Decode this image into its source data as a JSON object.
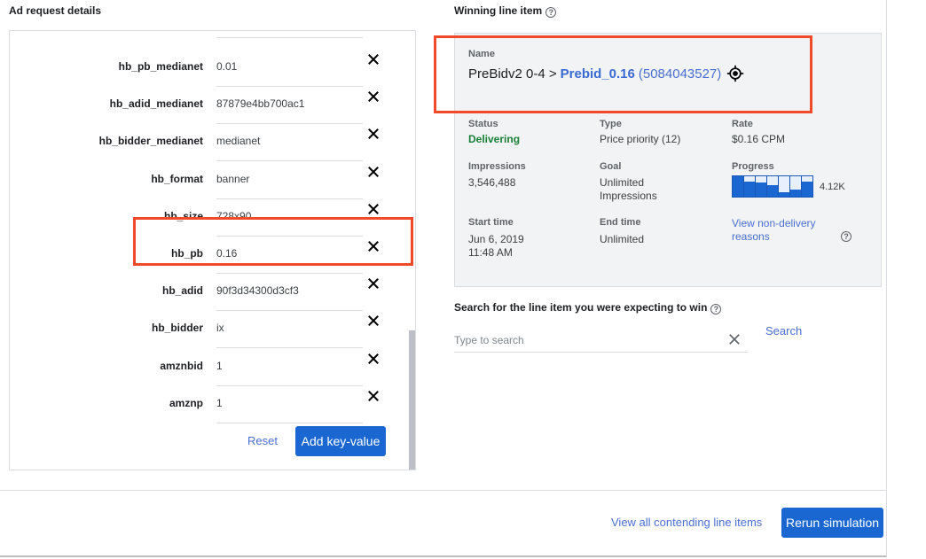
{
  "left": {
    "title": "Ad request details",
    "rows": [
      {
        "key": "hb_pb_medianet",
        "value": "0.01"
      },
      {
        "key": "hb_adid_medianet",
        "value": "87879e4bb700ac1"
      },
      {
        "key": "hb_bidder_medianet",
        "value": "medianet"
      },
      {
        "key": "hb_format",
        "value": "banner"
      },
      {
        "key": "hb_size",
        "value": "728x90"
      },
      {
        "key": "hb_pb",
        "value": "0.16"
      },
      {
        "key": "hb_adid",
        "value": "90f3d34300d3cf3"
      },
      {
        "key": "hb_bidder",
        "value": "ix"
      },
      {
        "key": "amznbid",
        "value": "1"
      },
      {
        "key": "amznp",
        "value": "1"
      }
    ],
    "reset_label": "Reset",
    "add_label": "Add key-value"
  },
  "right": {
    "title": "Winning line item",
    "help_glyph": "?",
    "name_label": "Name",
    "order_name": "PreBidv2 0-4 >",
    "line_item_name": "Prebid_0.16",
    "line_item_id": "(5084043527)",
    "status_label": "Status",
    "status_value": "Delivering",
    "status_color": "#188038",
    "type_label": "Type",
    "type_value": "Price priority (12)",
    "rate_label": "Rate",
    "rate_value": "$0.16 CPM",
    "impressions_label": "Impressions",
    "impressions_value": "3,546,488",
    "goal_label": "Goal",
    "goal_value_line1": "Unlimited",
    "goal_value_line2": "Impressions",
    "progress_label": "Progress",
    "progress_value": "4.12K",
    "progress_bars": [
      1.0,
      0.76,
      0.68,
      0.58,
      0.2,
      0.36,
      0.76
    ],
    "start_label": "Start time",
    "start_date": "Jun 6, 2019",
    "start_time": "11:48 AM",
    "end_label": "End time",
    "end_value": "Unlimited",
    "nondelivery_line1": "View non-delivery",
    "nondelivery_line2": "reasons"
  },
  "search": {
    "title": "Search for the line item you were expecting to win",
    "placeholder": "Type to search",
    "value": "",
    "button_label": "Search"
  },
  "footer": {
    "contending_label": "View all contending line items",
    "rerun_label": "Rerun simulation"
  },
  "colors": {
    "primary": "#1a67d2",
    "link": "#4a6fd1",
    "highlight": "#f04a2a"
  }
}
